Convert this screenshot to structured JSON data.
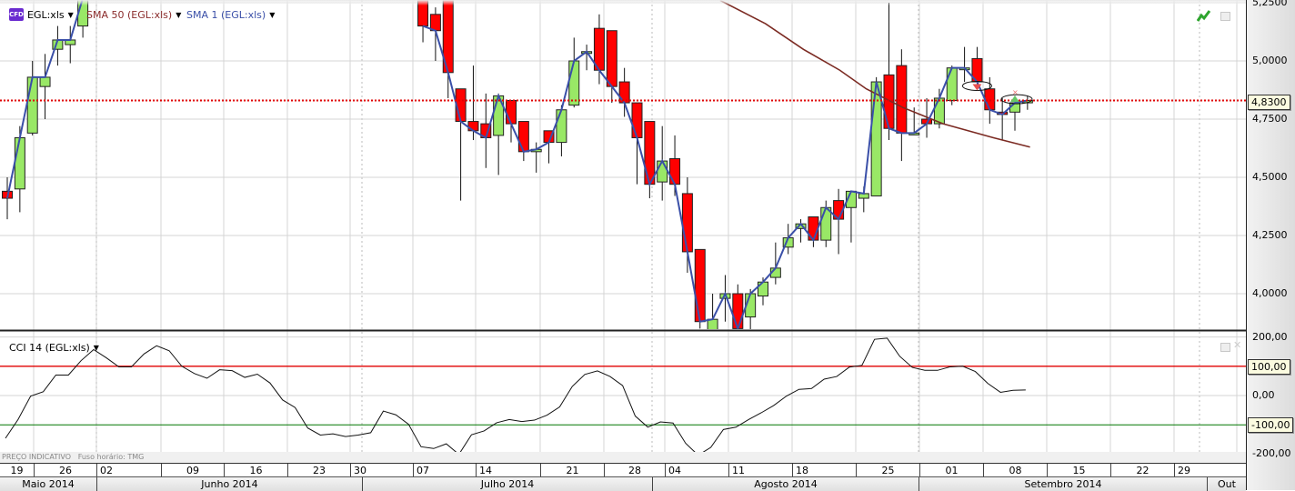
{
  "legend": {
    "instrument_badge": "CFD",
    "instrument": "EGL:xls",
    "sma50": "SMA 50 (EGL:xls)",
    "sma1": "SMA 1 (EGL:xls)",
    "cci": "CCI 14 (EGL:xls)"
  },
  "colors": {
    "up": "#99e866",
    "down": "#ff0000",
    "sma50": "#7b2a22",
    "sma1": "#3a4fa8",
    "last_price_line": "#e00000",
    "cci_upper": "#e00000",
    "cci_lower": "#007700"
  },
  "last_price_label": "4,8300",
  "cci_upper_label": "100,00",
  "cci_lower_label": "-100,00",
  "footer": {
    "indicative": "PREÇO INDICATIVO",
    "timezone": "Fuso horário: TMG"
  },
  "price_ticks": [
    {
      "value": 5.25,
      "label": "5,2500"
    },
    {
      "value": 5.0,
      "label": "5,0000"
    },
    {
      "value": 4.75,
      "label": "4,7500"
    },
    {
      "value": 4.5,
      "label": "4,5000"
    },
    {
      "value": 4.25,
      "label": "4,2500"
    },
    {
      "value": 4.0,
      "label": "4,0000"
    }
  ],
  "cci_ticks": [
    {
      "value": 200,
      "label": "200,00"
    },
    {
      "value": 100,
      "label": "100,00"
    },
    {
      "value": 0,
      "label": "0,00"
    },
    {
      "value": -100,
      "label": "-100,00"
    },
    {
      "value": -200,
      "label": "-200,00"
    }
  ],
  "week_labels": [
    "19",
    "26",
    "02",
    "09",
    "16",
    "23",
    "30",
    "07",
    "14",
    "21",
    "28",
    "04",
    "11",
    "18",
    "25",
    "01",
    "08",
    "15",
    "22",
    "29"
  ],
  "month_labels": [
    "Maio 2014",
    "Junho 2014",
    "Julho 2014",
    "Agosto 2014",
    "Setembro 2014",
    "Out"
  ],
  "chart_data": [
    {
      "type": "candlestick",
      "title": "EGL:xls",
      "ylim": [
        3.85,
        5.26
      ],
      "last_price": 4.83,
      "ohlc_fields": [
        "open",
        "high",
        "low",
        "close"
      ],
      "ohlc": [
        [
          4.44,
          4.5,
          4.32,
          4.41
        ],
        [
          4.45,
          4.72,
          4.35,
          4.67
        ],
        [
          4.69,
          5.0,
          4.68,
          4.93
        ],
        [
          4.89,
          5.03,
          4.75,
          4.93
        ],
        [
          5.05,
          5.15,
          4.98,
          5.09
        ],
        [
          5.07,
          5.15,
          4.99,
          5.09
        ],
        [
          5.15,
          5.3,
          5.1,
          5.27
        ],
        null,
        null,
        null,
        null,
        null,
        null,
        null,
        null,
        null,
        null,
        null,
        null,
        null,
        null,
        null,
        null,
        null,
        null,
        null,
        null,
        null,
        null,
        null,
        null,
        null,
        null,
        [
          5.27,
          5.3,
          5.08,
          5.15
        ],
        [
          5.2,
          5.23,
          5.0,
          5.13
        ],
        [
          5.3,
          5.32,
          4.84,
          4.95
        ],
        [
          4.88,
          4.88,
          4.4,
          4.74
        ],
        [
          4.74,
          4.98,
          4.66,
          4.7
        ],
        [
          4.73,
          4.86,
          4.54,
          4.67
        ],
        [
          4.68,
          4.86,
          4.51,
          4.85
        ],
        [
          4.83,
          4.83,
          4.65,
          4.73
        ],
        [
          4.74,
          4.74,
          4.57,
          4.61
        ],
        [
          4.61,
          4.65,
          4.52,
          4.62
        ],
        [
          4.7,
          4.7,
          4.56,
          4.65
        ],
        [
          4.65,
          4.81,
          4.59,
          4.79
        ],
        [
          4.81,
          5.1,
          4.8,
          5.0
        ],
        [
          5.04,
          5.07,
          4.96,
          5.04
        ],
        [
          5.14,
          5.2,
          4.9,
          4.96
        ],
        [
          5.13,
          5.13,
          4.82,
          4.89
        ],
        [
          4.91,
          4.97,
          4.76,
          4.82
        ],
        [
          4.82,
          4.82,
          4.47,
          4.67
        ],
        [
          4.74,
          4.74,
          4.41,
          4.47
        ],
        [
          4.48,
          4.72,
          4.4,
          4.57
        ],
        [
          4.58,
          4.68,
          4.42,
          4.47
        ],
        [
          4.43,
          4.5,
          4.09,
          4.18
        ],
        [
          4.19,
          4.19,
          3.85,
          3.88
        ],
        [
          3.84,
          4.0,
          3.84,
          3.89
        ],
        [
          3.98,
          4.08,
          3.88,
          4.0
        ],
        [
          4.0,
          4.04,
          3.84,
          3.85
        ],
        [
          3.9,
          4.02,
          3.84,
          4.0
        ],
        [
          3.99,
          4.07,
          3.95,
          4.05
        ],
        [
          4.07,
          4.22,
          4.04,
          4.11
        ],
        [
          4.2,
          4.3,
          4.17,
          4.24
        ],
        [
          4.28,
          4.32,
          4.22,
          4.3
        ],
        [
          4.33,
          4.33,
          4.2,
          4.23
        ],
        [
          4.23,
          4.4,
          4.2,
          4.37
        ],
        [
          4.4,
          4.45,
          4.17,
          4.32
        ],
        [
          4.37,
          4.44,
          4.22,
          4.44
        ],
        [
          4.41,
          4.46,
          4.35,
          4.43
        ],
        [
          4.42,
          4.93,
          4.42,
          4.91
        ],
        [
          4.94,
          5.25,
          4.66,
          4.71
        ],
        [
          4.98,
          5.05,
          4.57,
          4.69
        ],
        [
          4.69,
          4.8,
          4.69,
          4.69
        ],
        [
          4.75,
          4.84,
          4.67,
          4.73
        ],
        [
          4.73,
          4.88,
          4.71,
          4.84
        ],
        [
          4.83,
          4.98,
          4.81,
          4.97
        ],
        [
          4.97,
          5.06,
          4.91,
          4.97
        ],
        [
          5.01,
          5.06,
          4.9,
          4.91
        ],
        [
          4.88,
          4.93,
          4.73,
          4.79
        ],
        [
          4.78,
          4.84,
          4.66,
          4.77
        ],
        [
          4.78,
          4.85,
          4.7,
          4.82
        ],
        [
          4.82,
          4.85,
          4.79,
          4.83
        ]
      ],
      "sma50": [
        [
          56.6,
          5.26
        ],
        [
          60.2,
          5.16
        ],
        [
          63.2,
          5.05
        ],
        [
          66.1,
          4.96
        ],
        [
          68.2,
          4.88
        ],
        [
          71.1,
          4.8
        ],
        [
          74.3,
          4.73
        ],
        [
          78.3,
          4.67
        ],
        [
          81.2,
          4.63
        ]
      ],
      "signals": [
        {
          "index": 77,
          "type": "sell"
        },
        {
          "index": 80,
          "type": "buy"
        }
      ]
    },
    {
      "type": "line",
      "title": "CCI 14 (EGL:xls)",
      "ylim": [
        -200,
        200
      ],
      "levels": [
        100,
        -100
      ],
      "values": [
        -146,
        -82,
        -2,
        13,
        70,
        70,
        119,
        157,
        129,
        98,
        98,
        142,
        170,
        153,
        100,
        75,
        59,
        88,
        85,
        62,
        73,
        43,
        -15,
        -41,
        -111,
        -135,
        -131,
        -140,
        -135,
        -127,
        -53,
        -66,
        -98,
        -175,
        -181,
        -165,
        -201,
        -134,
        -121,
        -93,
        -82,
        -89,
        -84,
        -67,
        -39,
        31,
        72,
        84,
        65,
        34,
        -70,
        -108,
        -90,
        -94,
        -163,
        -204,
        -177,
        -116,
        -108,
        -82,
        -59,
        -34,
        -2,
        21,
        24,
        56,
        65,
        97,
        103,
        192,
        196,
        134,
        96,
        86,
        86,
        98,
        100,
        82,
        41,
        11,
        18,
        19
      ]
    }
  ]
}
